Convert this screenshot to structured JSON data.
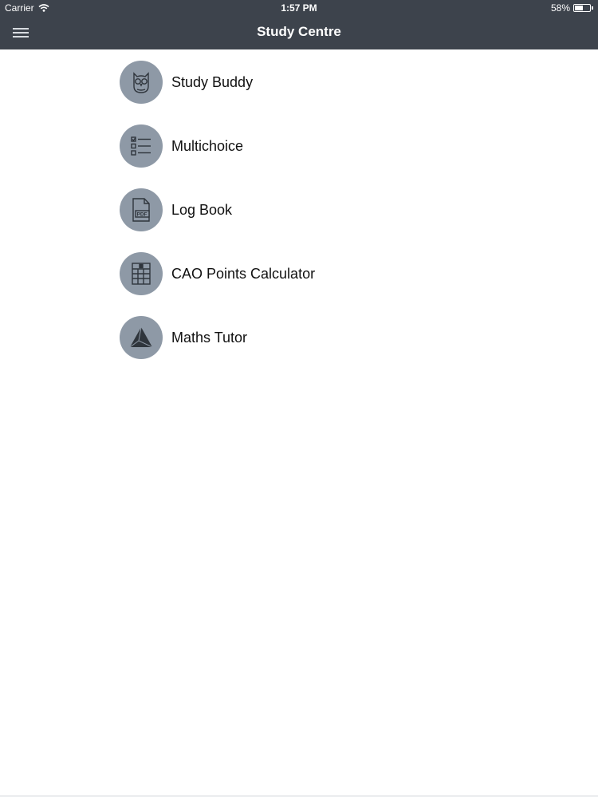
{
  "status_bar": {
    "carrier": "Carrier",
    "time": "1:57 PM",
    "battery": "58%",
    "battery_level": 0.58
  },
  "nav": {
    "title": "Study Centre",
    "menu_icon": "hamburger-menu-icon"
  },
  "colors": {
    "header_bg": "#3d434c",
    "icon_circle": "#8e99a6",
    "icon_stroke": "#2f353c"
  },
  "menu_items": [
    {
      "label": "Study Buddy",
      "icon": "owl-icon"
    },
    {
      "label": "Multichoice",
      "icon": "checklist-icon"
    },
    {
      "label": "Log Book",
      "icon": "pdf-document-icon"
    },
    {
      "label": "CAO Points Calculator",
      "icon": "grid-calculator-icon"
    },
    {
      "label": "Maths Tutor",
      "icon": "triangle-icon"
    }
  ]
}
